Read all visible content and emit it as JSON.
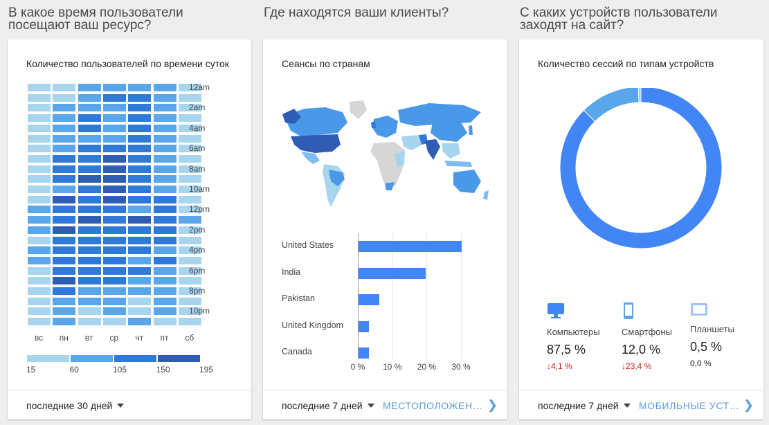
{
  "columns": [
    {
      "title": "В какое время пользователи посещают ваш ресурс?"
    },
    {
      "title": "Где находятся ваши клиенты?"
    },
    {
      "title": "С каких устройств пользователи заходят на сайт?"
    }
  ],
  "colors": {
    "accent": "#4285f4",
    "link": "#5c9ad6",
    "down": "#c5221f",
    "hm1": "#a7d5ee",
    "hm2": "#5aa6ea",
    "hm3": "#2f79d9",
    "hm4": "#2e5db3"
  },
  "heatmap_card": {
    "title": "Количество пользователей по времени суток",
    "hours": [
      "12am",
      "2am",
      "4am",
      "6am",
      "8am",
      "10am",
      "12pm",
      "2pm",
      "4pm",
      "6pm",
      "8pm",
      "10pm"
    ],
    "days": [
      "вс",
      "пн",
      "вт",
      "ср",
      "чт",
      "пт",
      "сб"
    ],
    "legend": [
      "15",
      "60",
      "105",
      "150",
      "195"
    ],
    "levels": [
      [
        1,
        1,
        2,
        2,
        2,
        2,
        1
      ],
      [
        1,
        1,
        2,
        3,
        3,
        2,
        1
      ],
      [
        1,
        2,
        2,
        2,
        3,
        2,
        1
      ],
      [
        1,
        2,
        3,
        2,
        3,
        2,
        1
      ],
      [
        1,
        2,
        3,
        2,
        3,
        2,
        1
      ],
      [
        1,
        2,
        2,
        2,
        3,
        2,
        1
      ],
      [
        1,
        2,
        3,
        3,
        3,
        2,
        1
      ],
      [
        1,
        3,
        3,
        4,
        3,
        2,
        1
      ],
      [
        1,
        3,
        3,
        4,
        3,
        2,
        1
      ],
      [
        1,
        3,
        4,
        4,
        3,
        2,
        1
      ],
      [
        1,
        2,
        3,
        4,
        3,
        2,
        1
      ],
      [
        1,
        4,
        3,
        4,
        3,
        3,
        1
      ],
      [
        2,
        3,
        3,
        3,
        2,
        3,
        1
      ],
      [
        2,
        3,
        4,
        3,
        4,
        3,
        2
      ],
      [
        2,
        4,
        3,
        3,
        3,
        3,
        1
      ],
      [
        1,
        3,
        3,
        3,
        3,
        3,
        1
      ],
      [
        2,
        3,
        3,
        3,
        3,
        2,
        1
      ],
      [
        2,
        3,
        3,
        3,
        2,
        3,
        1
      ],
      [
        1,
        3,
        3,
        3,
        3,
        2,
        1
      ],
      [
        1,
        4,
        3,
        3,
        2,
        2,
        1
      ],
      [
        1,
        3,
        2,
        2,
        2,
        2,
        1
      ],
      [
        1,
        2,
        2,
        2,
        1,
        2,
        1
      ],
      [
        1,
        2,
        1,
        2,
        1,
        2,
        1
      ],
      [
        1,
        2,
        1,
        1,
        2,
        1,
        1
      ]
    ],
    "period": "последние 30 дней"
  },
  "geo_card": {
    "title": "Сеансы по странам",
    "period": "последние 7 дней",
    "link": "МЕСТОПОЛОЖЕНИЯ"
  },
  "device_card": {
    "title": "Количество сессий по типам устройств",
    "period": "последние 7 дней",
    "link": "МОБИЛЬНЫЕ УСТРОЙСТВА",
    "devices": [
      {
        "name": "Компьютеры",
        "value": "87,5 %",
        "change": "↓4,1 %"
      },
      {
        "name": "Смартфоны",
        "value": "12,0 %",
        "change": "↓23,4 %"
      },
      {
        "name": "Планшеты",
        "value": "0,5 %",
        "change": "0,0 %"
      }
    ]
  },
  "chart_data": [
    {
      "type": "bar",
      "title": "Сеансы по странам",
      "categories": [
        "United States",
        "India",
        "Pakistan",
        "United Kingdom",
        "Canada"
      ],
      "values": [
        30,
        19.5,
        6,
        3,
        3
      ],
      "xlim": [
        0,
        30
      ],
      "ticks": [
        "0 %",
        "10 %",
        "20 %",
        "30 %"
      ],
      "grid": true
    },
    {
      "type": "pie",
      "title": "Количество сессий по типам устройств",
      "categories": [
        "Компьютеры",
        "Смартфоны",
        "Планшеты"
      ],
      "values": [
        87.5,
        12.0,
        0.5
      ],
      "colors": [
        "#4285f4",
        "#5aa6ea",
        "#9fc5f8"
      ]
    }
  ]
}
